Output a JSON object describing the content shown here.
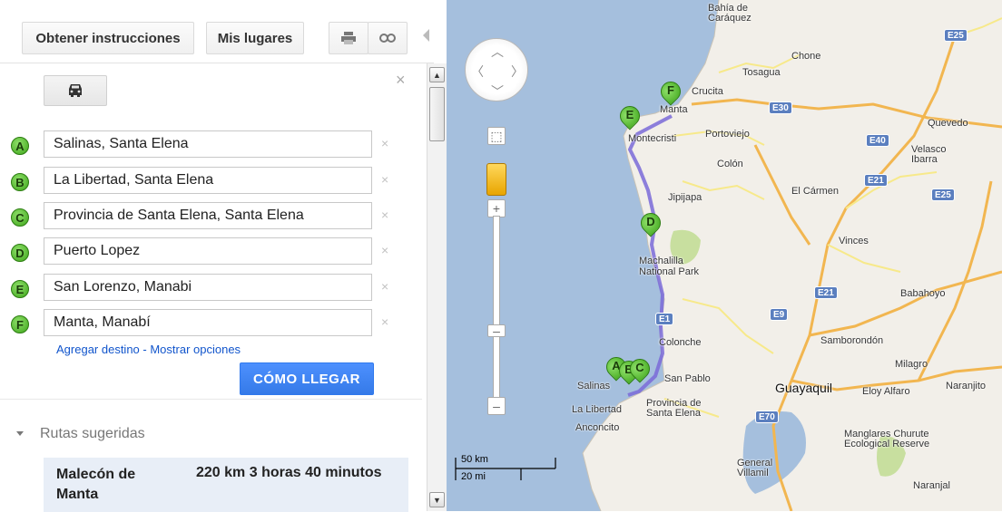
{
  "toolbar": {
    "directions_label": "Obtener instrucciones",
    "my_places_label": "Mis lugares"
  },
  "waypoints": [
    {
      "marker": "A",
      "value": "Salinas, Santa Elena"
    },
    {
      "marker": "B",
      "value": "La Libertad, Santa Elena"
    },
    {
      "marker": "C",
      "value": "Provincia de Santa Elena, Santa Elena"
    },
    {
      "marker": "D",
      "value": "Puerto Lopez"
    },
    {
      "marker": "E",
      "value": "San Lorenzo, Manabi"
    },
    {
      "marker": "F",
      "value": "Manta, Manabí"
    }
  ],
  "links": {
    "add_destination": "Agregar destino",
    "separator": " - ",
    "show_options": "Mostrar opciones"
  },
  "go_button": "CÓMO LLEGAR",
  "routes": {
    "header": "Rutas sugeridas",
    "items": [
      {
        "name": "Malecón de Manta",
        "distance": "220 km",
        "duration": "3 horas 40 minutos"
      }
    ]
  },
  "map": {
    "labels": {
      "bahia": "Bahía de Caráquez",
      "chone": "Chone",
      "tosagua": "Tosagua",
      "crucita": "Crucita",
      "manta": "Manta",
      "portoviejo": "Portoviejo",
      "montecristi": "Montecristi",
      "colon": "Colón",
      "quevedo": "Quevedo",
      "velasco": "Velasco Ibarra",
      "jipijapa": "Jipijapa",
      "elcarmen": "El Cármen",
      "vinces": "Vinces",
      "machalilla": "Machalilla National Park",
      "babahoyo": "Babahoyo",
      "colonche": "Colonche",
      "samborondon": "Samborondón",
      "milagro": "Milagro",
      "sanpablo": "San Pablo",
      "salinas": "Salinas",
      "guayaquil": "Guayaquil",
      "eloyalfaro": "Eloy Alfaro",
      "naranjito": "Naranjito",
      "lalibertad": "La Libertad",
      "provincia": "Provincia de Santa Elena",
      "ancon": "Anconcito",
      "manglares": "Manglares Churute Ecological Reserve",
      "general": "General Villamil",
      "naranjal": "Naranjal"
    },
    "highways": [
      "E25",
      "E30",
      "E40",
      "E21",
      "E25",
      "E21",
      "E9",
      "E70",
      "E1"
    ],
    "pins": [
      "A",
      "B",
      "C",
      "D",
      "E",
      "F"
    ],
    "scale_km": "50 km",
    "scale_mi": "20 mi"
  },
  "colors": {
    "route": "#7a6ad8",
    "marker_green": "#3ea51a",
    "go_button": "#4d90fe",
    "highway_badge": "#5b7fbf"
  }
}
